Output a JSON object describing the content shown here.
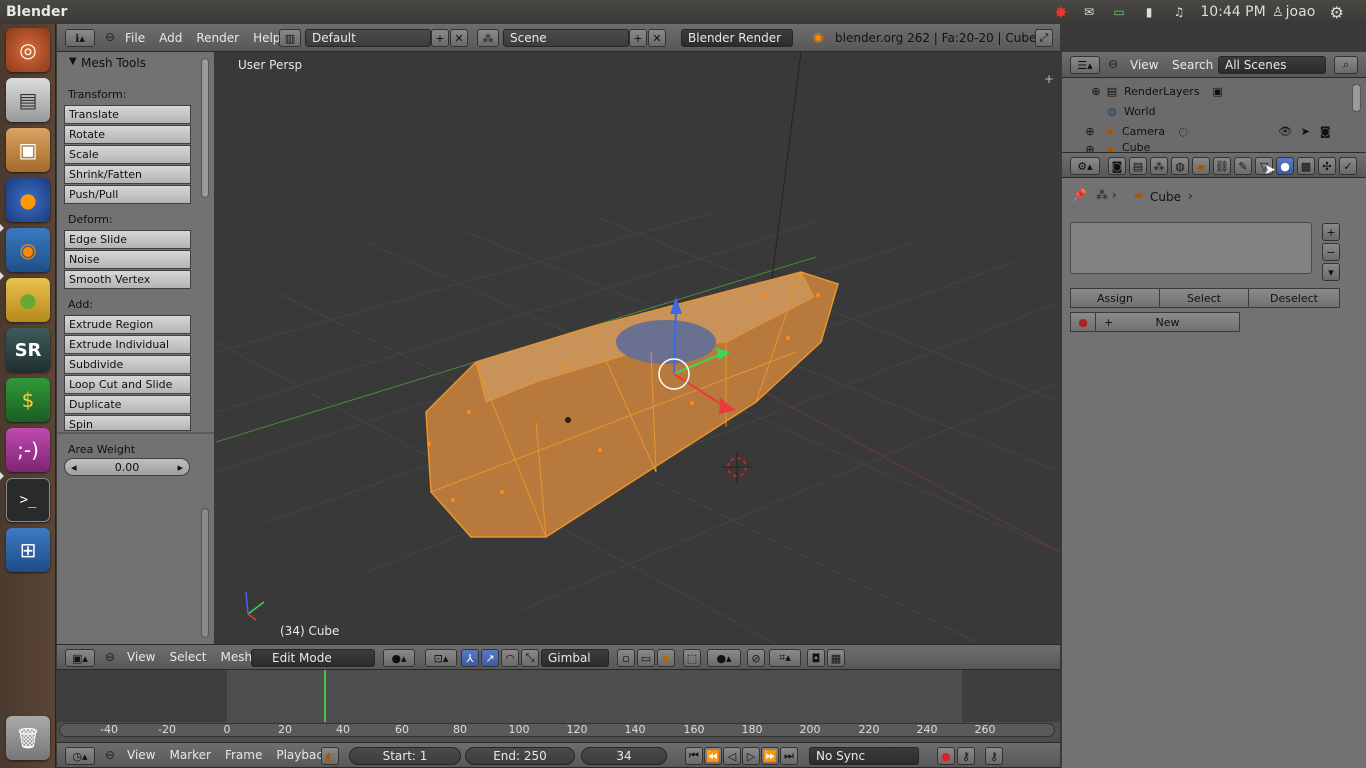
{
  "top_bar": {
    "app_title": "Blender",
    "clock": "10:44 PM",
    "user": "joao"
  },
  "info_header": {
    "menus": [
      "File",
      "Add",
      "Render",
      "Help"
    ],
    "layout": "Default",
    "scene": "Scene",
    "engine": "Blender Render",
    "stats": "blender.org 262 | Fa:20-20 | Cube"
  },
  "tool_panel": {
    "title": "Mesh Tools",
    "transform_label": "Transform:",
    "transform": [
      "Translate",
      "Rotate",
      "Scale",
      "Shrink/Fatten",
      "Push/Pull"
    ],
    "deform_label": "Deform:",
    "deform": [
      "Edge Slide",
      "Noise",
      "Smooth Vertex"
    ],
    "add_label": "Add:",
    "add": [
      "Extrude Region",
      "Extrude Individual",
      "Subdivide",
      "Loop Cut and Slide",
      "Duplicate",
      "Spin"
    ],
    "area_weight_label": "Area Weight",
    "area_weight_value": "0.00"
  },
  "viewport": {
    "view_name": "User Persp",
    "object_info": "(34) Cube",
    "colors": {
      "mesh": "#e8952e",
      "background": "#393939"
    }
  },
  "view3d_header": {
    "menus": [
      "View",
      "Select",
      "Mesh"
    ],
    "mode": "Edit Mode",
    "orientation": "Gimbal"
  },
  "timeline": {
    "ticks": [
      "-40",
      "-20",
      "0",
      "20",
      "40",
      "60",
      "80",
      "100",
      "120",
      "140",
      "160",
      "180",
      "200",
      "220",
      "240",
      "260"
    ],
    "menus": [
      "View",
      "Marker",
      "Frame",
      "Playback"
    ],
    "start": "Start: 1",
    "end": "End: 250",
    "current": "34",
    "sync": "No Sync"
  },
  "outliner": {
    "menus": [
      "View",
      "Search"
    ],
    "filter": "All Scenes",
    "items": [
      "RenderLayers",
      "World",
      "Camera",
      "Cube"
    ]
  },
  "properties": {
    "context": "Cube",
    "buttons": [
      "Assign",
      "Select",
      "Deselect"
    ],
    "new_label": "New"
  }
}
